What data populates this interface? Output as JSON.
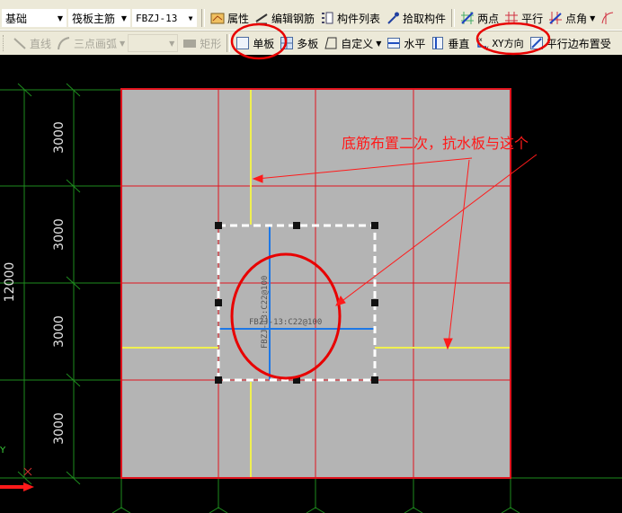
{
  "toolbar1": {
    "layer_combo": "基础",
    "type_combo": "筏板主筋",
    "name_combo": "FBZJ-13",
    "properties": "属性",
    "edit_rebar": "编辑钢筋",
    "component_list": "构件列表",
    "pick_component": "拾取构件",
    "two_points": "两点",
    "parallel": "平行",
    "point_angle": "点角"
  },
  "toolbar2": {
    "line": "直线",
    "three_point_arc": "三点画弧",
    "arc_combo": "",
    "rectangle": "矩形",
    "single_slab": "单板",
    "multi_slab": "多板",
    "custom": "自定义",
    "horizontal": "水平",
    "vertical": "垂直",
    "xy_direction": "XY方向",
    "parallel_edge": "平行边布置受"
  },
  "canvas": {
    "dimensions": {
      "total": "12000",
      "segments": [
        "3000",
        "3000",
        "3000",
        "3000"
      ]
    },
    "rebar_label_horizontal": "FBZJ-13:C22@100",
    "rebar_label_vertical": "FBZJ-13:C22@100",
    "annotation": "底筋布置二次，抗水板与这个",
    "axis_y_label": "Y",
    "colors": {
      "slab": "#b4b4b4",
      "grid_red": "#e0141e",
      "axis_green": "#1e8c1e",
      "rebar_yellow": "#f0f050",
      "rebar_blue": "#1e78e6",
      "highlight": "#e80000"
    }
  }
}
